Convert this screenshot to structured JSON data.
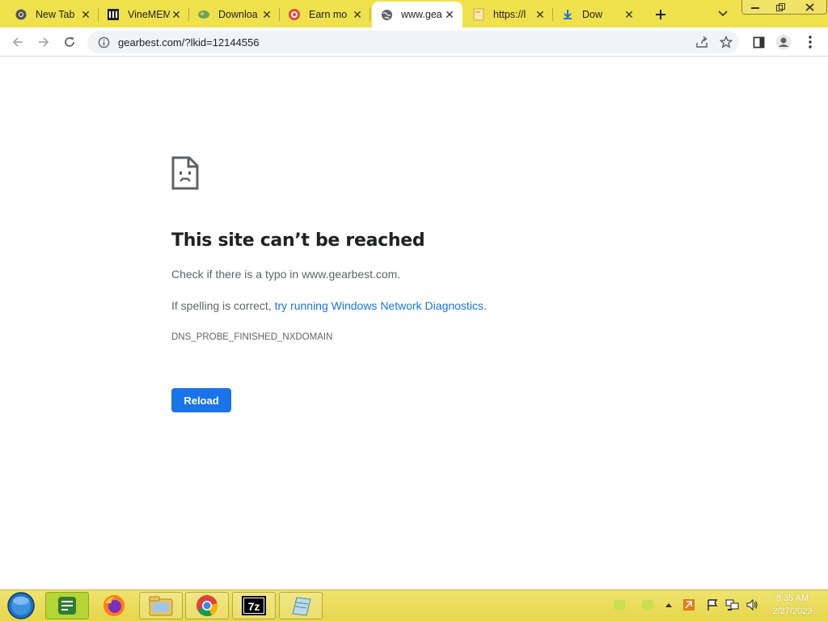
{
  "tabs": [
    {
      "title": "New Tab",
      "icon": "chrome-icon"
    },
    {
      "title": "VineMEM",
      "icon": "bank-icon"
    },
    {
      "title": "Downloa",
      "icon": "download-site-icon"
    },
    {
      "title": "Earn mo",
      "icon": "target-icon"
    },
    {
      "title": "www.gea",
      "icon": "globe-icon",
      "active": true
    },
    {
      "title": "https://l",
      "icon": "page-icon"
    },
    {
      "title": "Dow",
      "icon": "download-icon"
    }
  ],
  "address_bar": {
    "url": "gearbest.com/?lkid=12144556"
  },
  "error_page": {
    "headline": "This site can’t be reached",
    "line1": "Check if there is a typo in www.gearbest.com.",
    "line2_prefix": "If spelling is correct, ",
    "line2_link": "try running Windows Network Diagnostics",
    "line2_suffix": ".",
    "error_code": "DNS_PROBE_FINISHED_NXDOMAIN",
    "reload_label": "Reload"
  },
  "taskbar": {
    "apps": [
      "start-orb",
      "notes-app",
      "firefox",
      "file-explorer",
      "chrome",
      "7zip",
      "notepad-app"
    ],
    "time": "8:35 AM",
    "date": "2/27/2023"
  },
  "colors": {
    "accent": "#1a73e8",
    "tabbar": "#efe14c",
    "taskbar": "#e9da55"
  }
}
